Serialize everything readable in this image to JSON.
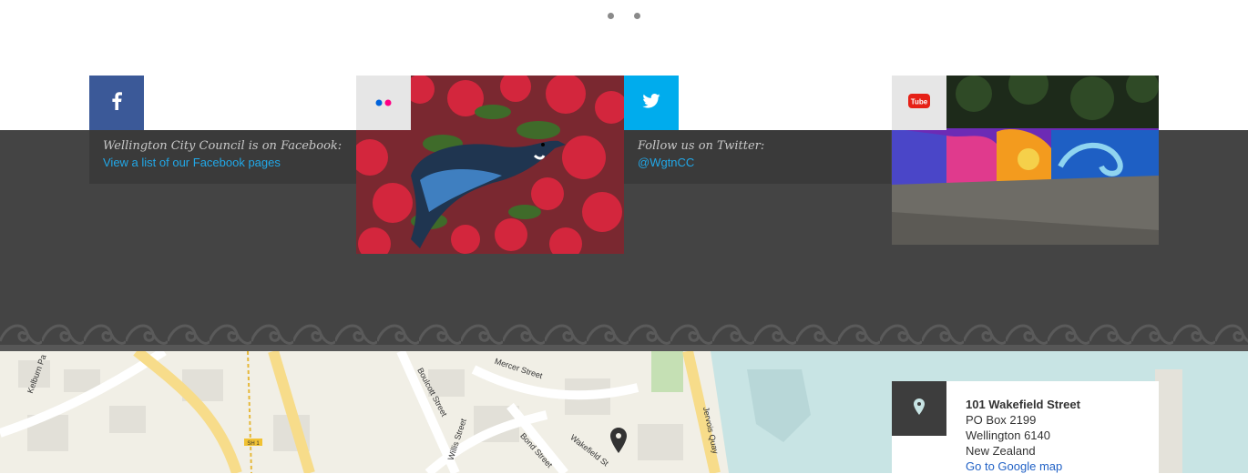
{
  "carousel": {
    "dots": [
      {
        "label": "slide-1"
      },
      {
        "label": "slide-2"
      }
    ]
  },
  "social": {
    "facebook": {
      "icon": "facebook-icon",
      "color": "#3b5998",
      "intro": "Wellington City Council is on Facebook:",
      "link": "View a list of our Facebook pages"
    },
    "flickr": {
      "icon": "flickr-icon",
      "color": "#e6e6e6",
      "photo": "tui-bird-in-pohutukawa-flowers"
    },
    "twitter": {
      "icon": "twitter-icon",
      "color": "#00aced",
      "intro": "Follow us on Twitter:",
      "link": "@WgtnCC"
    },
    "youtube": {
      "icon": "youtube-icon",
      "color": "#e6e6e6",
      "photo": "street-art-mural-wall"
    }
  },
  "map": {
    "streets": [
      "Kelburn Pa",
      "Boulcott Street",
      "Mercer Street",
      "Willis Street",
      "Bond Street",
      "Wakefield St",
      "Jervois Quay",
      "SH 1"
    ],
    "pin_icon": "map-pin-icon"
  },
  "address": {
    "icon": "location-pin-icon",
    "line1": "101 Wakefield Street",
    "line2": "PO Box 2199",
    "line3": "Wellington 6140",
    "line4": "New Zealand",
    "map_link": "Go to Google map"
  }
}
